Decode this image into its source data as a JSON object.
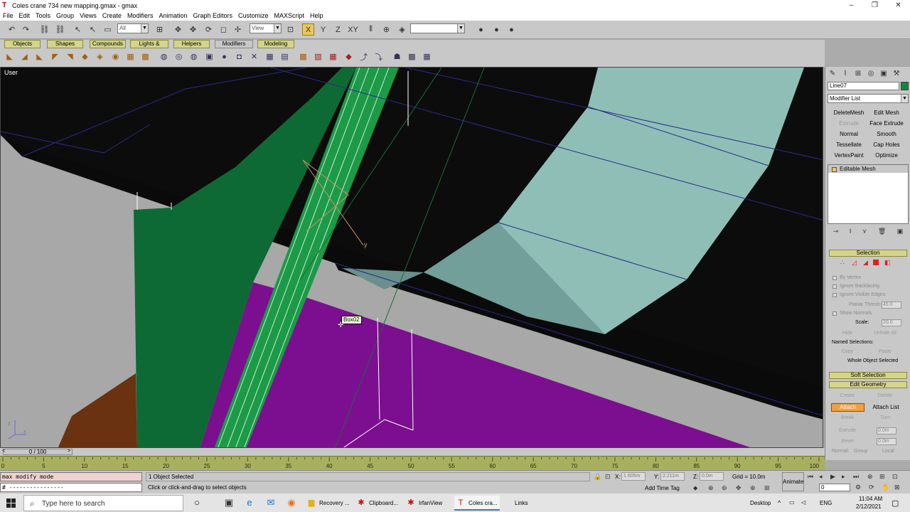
{
  "window": {
    "title": "Coles crane 734 new mapping.gmax - gmax",
    "controls": [
      "–",
      "❐",
      "✕"
    ]
  },
  "menu": [
    "File",
    "Edit",
    "Tools",
    "Group",
    "Views",
    "Create",
    "Modifiers",
    "Animation",
    "Graph Editors",
    "Customize",
    "MAXScript",
    "Help"
  ],
  "toolbar": {
    "selection_filter": "All",
    "ref_coord": "View",
    "named_sel": ""
  },
  "tabs": [
    "Objects",
    "Shapes",
    "Compounds",
    "Lights & Cameras",
    "Helpers",
    "Modifiers",
    "Modeling"
  ],
  "viewport": {
    "label": "User",
    "tooltip": "Box02",
    "axis_x": "x",
    "axis_y": "y",
    "gizmo_x": "x",
    "gizmo_y": "y"
  },
  "command_panel": {
    "object_name": "Line07",
    "object_color": "#0c8a3a",
    "modifier_list": "Modifier List",
    "mod_buttons": [
      {
        "label": "DeleteMesh",
        "enabled": true
      },
      {
        "label": "Edit Mesh",
        "enabled": true
      },
      {
        "label": "Extrude",
        "enabled": false
      },
      {
        "label": "Face Extrude",
        "enabled": true
      },
      {
        "label": "Normal",
        "enabled": true
      },
      {
        "label": "Smooth",
        "enabled": true
      },
      {
        "label": "Tessellate",
        "enabled": true
      },
      {
        "label": "Cap Holes",
        "enabled": true
      },
      {
        "label": "VertexPaint",
        "enabled": true
      },
      {
        "label": "Optimize",
        "enabled": true
      }
    ],
    "stack_item": "Editable Mesh",
    "selection": {
      "title": "Selection",
      "by_vertex": "By Vertex",
      "ignore_backfacing": "Ignore Backfacing",
      "ignore_visible_edges": "Ignore Visible Edges",
      "planar_thresh": "Planar Thresh:",
      "planar_value": "45.0",
      "show_normals": "Show Normals",
      "scale": "Scale:",
      "scale_value": "20.0",
      "hide": "Hide",
      "unhide_all": "Unhide All",
      "named_selections": "Named Selections:",
      "copy": "Copy",
      "paste": "Paste",
      "whole_object": "Whole Object Selected"
    },
    "soft_selection": "Soft Selection",
    "edit_geometry": {
      "title": "Edit Geometry",
      "create": "Create",
      "delete": "Delete",
      "attach": "Attach",
      "attach_list": "Attach List",
      "break": "Break",
      "turn": "Turn",
      "extrude": "Extrude",
      "extrude_value": "0.0m",
      "bevel": "Bevel",
      "bevel_value": "0.0m",
      "normal": "Normal:",
      "group": "Group",
      "local": "Local"
    }
  },
  "time_slider": {
    "label": "0 / 100",
    "left": "<",
    "right": ">"
  },
  "track_ticks": [
    "0",
    "5",
    "10",
    "15",
    "20",
    "25",
    "30",
    "35",
    "40",
    "45",
    "50",
    "55",
    "60",
    "65",
    "70",
    "75",
    "80",
    "85",
    "90",
    "95",
    "100"
  ],
  "status": {
    "maxscript_line1": "max modify mode",
    "maxscript_line2": "# ----------------",
    "selected": "1 Object Selected",
    "prompt": "Click or click-and-drag to select objects",
    "x_label": "X:",
    "x_value": "1.605m",
    "y_label": "Y:",
    "y_value": "2.211m",
    "z_label": "Z:",
    "z_value": "0.0m",
    "grid": "Grid = 10.0m",
    "add_time_tag": "Add Time Tag",
    "animate": "Animate",
    "frame": "0"
  },
  "taskbar": {
    "search_placeholder": "Type here to search",
    "apps": [
      {
        "label": "Recovery ...",
        "active": false
      },
      {
        "label": "Clipboard...",
        "active": false
      },
      {
        "label": "IrfanView",
        "active": false
      },
      {
        "label": "Coles cra...",
        "active": true
      }
    ],
    "links": "Links",
    "desktop": "Desktop",
    "lang": "ENG",
    "time": "11:04 AM",
    "date": "2/12/2021"
  }
}
